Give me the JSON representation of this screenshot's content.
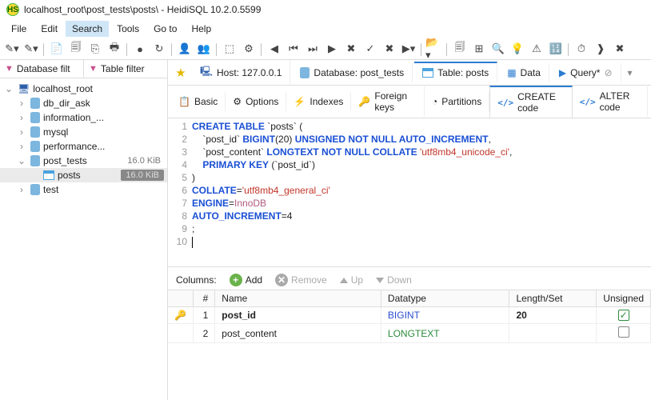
{
  "window": {
    "title": "localhost_root\\post_tests\\posts\\ - HeidiSQL 10.2.0.5599"
  },
  "menu": {
    "items": [
      "File",
      "Edit",
      "Search",
      "Tools",
      "Go to",
      "Help"
    ],
    "highlighted": 2
  },
  "filters": {
    "db": "Database filt",
    "table": "Table filter"
  },
  "tree": {
    "server": "localhost_root",
    "dbs": [
      {
        "label": "db_dir_ask"
      },
      {
        "label": "information_..."
      },
      {
        "label": "mysql"
      },
      {
        "label": "performance..."
      },
      {
        "label": "post_tests",
        "expanded": true,
        "size": "16.0 KiB",
        "tables": [
          {
            "label": "posts",
            "size": "16.0 KiB",
            "selected": true
          }
        ]
      },
      {
        "label": "test"
      }
    ]
  },
  "topTabs": {
    "host": {
      "label": "Host:",
      "value": "127.0.0.1"
    },
    "database": {
      "label": "Database:",
      "value": "post_tests"
    },
    "table": {
      "label": "Table:",
      "value": "posts"
    },
    "data": {
      "label": "Data"
    },
    "query": {
      "label": "Query*"
    }
  },
  "subTabs": {
    "items": [
      "Basic",
      "Options",
      "Indexes",
      "Foreign keys",
      "Partitions",
      "CREATE code",
      "ALTER code"
    ],
    "active": 5
  },
  "sql": {
    "lines": [
      [
        {
          "t": "CREATE TABLE",
          "c": "kw"
        },
        {
          "t": " `posts` ("
        }
      ],
      [
        {
          "t": "    `post_id` "
        },
        {
          "t": "BIGINT",
          "c": "ty"
        },
        {
          "t": "(20) "
        },
        {
          "t": "UNSIGNED NOT NULL AUTO_INCREMENT",
          "c": "kw"
        },
        {
          "t": ","
        }
      ],
      [
        {
          "t": "    `post_content` "
        },
        {
          "t": "LONGTEXT NOT NULL COLLATE",
          "c": "kw"
        },
        {
          "t": " "
        },
        {
          "t": "'utf8mb4_unicode_ci'",
          "c": "str"
        },
        {
          "t": ","
        }
      ],
      [
        {
          "t": "    "
        },
        {
          "t": "PRIMARY KEY",
          "c": "kw"
        },
        {
          "t": " (`post_id`)"
        }
      ],
      [
        {
          "t": ")"
        }
      ],
      [
        {
          "t": "COLLATE",
          "c": "kw"
        },
        {
          "t": "="
        },
        {
          "t": "'utf8mb4_general_ci'",
          "c": "str"
        }
      ],
      [
        {
          "t": "ENGINE",
          "c": "kw"
        },
        {
          "t": "="
        },
        {
          "t": "InnoDB",
          "c": "fn"
        }
      ],
      [
        {
          "t": "AUTO_INCREMENT",
          "c": "kw"
        },
        {
          "t": "=4"
        }
      ],
      [
        {
          "t": ";"
        }
      ],
      []
    ]
  },
  "columnsBar": {
    "title": "Columns:",
    "add": "Add",
    "remove": "Remove",
    "up": "Up",
    "down": "Down"
  },
  "grid": {
    "headers": {
      "num": "#",
      "name": "Name",
      "datatype": "Datatype",
      "length": "Length/Set",
      "unsigned": "Unsigned"
    },
    "rows": [
      {
        "pk": true,
        "num": "1",
        "name": "post_id",
        "datatype": "BIGINT",
        "dclass": "bigint",
        "length": "20",
        "unsigned": true
      },
      {
        "pk": false,
        "num": "2",
        "name": "post_content",
        "datatype": "LONGTEXT",
        "dclass": "longtext",
        "length": "",
        "unsigned": false
      }
    ]
  }
}
